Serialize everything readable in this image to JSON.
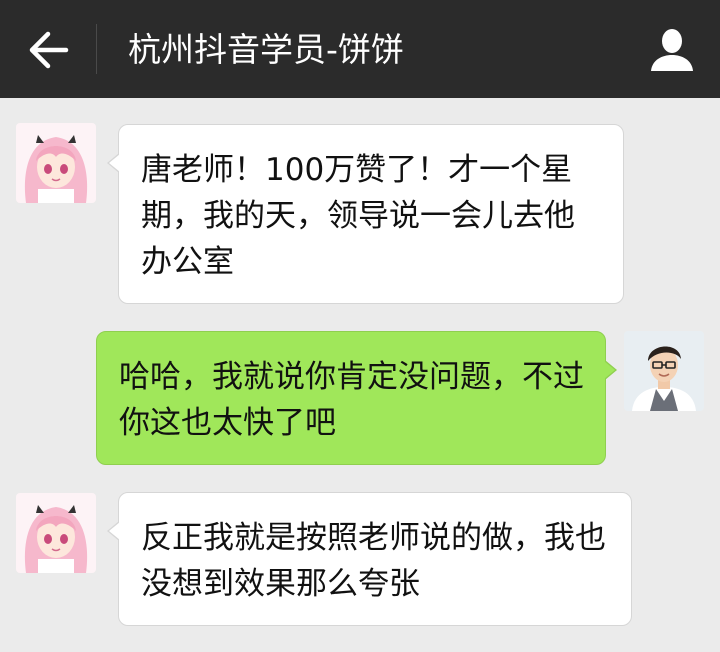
{
  "header": {
    "title": "杭州抖音学员-饼饼",
    "back_icon": "back-arrow-icon",
    "profile_icon": "person-icon"
  },
  "messages": [
    {
      "side": "incoming",
      "text": "唐老师！100万赞了！才一个星期，我的天，领导说一会儿去他办公室"
    },
    {
      "side": "outgoing",
      "text": "哈哈，我就说你肯定没问题，不过你这也太快了吧"
    },
    {
      "side": "incoming",
      "text": "反正我就是按照老师说的做，我也没想到效果那么夸张"
    }
  ],
  "colors": {
    "topbar": "#2b2b2b",
    "background": "#ebebeb",
    "incoming_bubble": "#ffffff",
    "outgoing_bubble": "#a0e75a"
  }
}
